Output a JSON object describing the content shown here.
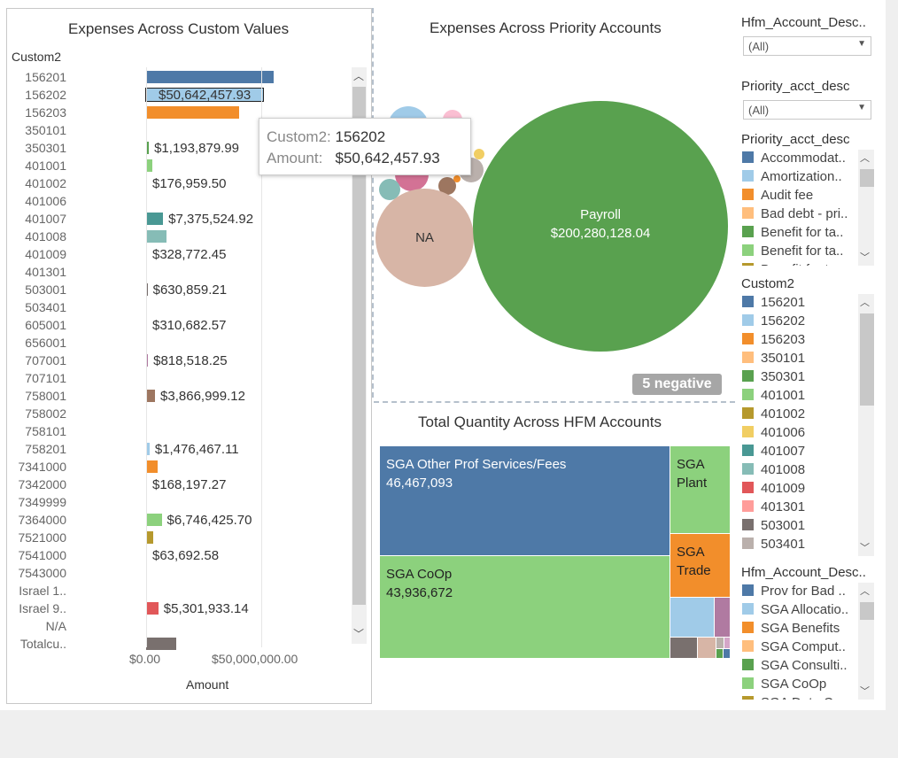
{
  "left_chart": {
    "title": "Expenses Across Custom Values",
    "dim_header": "Custom2",
    "x_axis_title": "Amount",
    "x_ticks": [
      "$0.00",
      "$50,000,000.00"
    ]
  },
  "tooltip": {
    "k1": "Custom2:",
    "v1": "156202",
    "k2": "Amount:",
    "v2": "$50,642,457.93"
  },
  "chart_data": [
    {
      "type": "bar",
      "title": "Expenses Across Custom Values",
      "xlabel": "Amount",
      "ylabel": "Custom2",
      "xlim": [
        0,
        95000000
      ],
      "rows": [
        {
          "cat": "156201",
          "value": 55500000,
          "label": "",
          "color": "#4e79a7"
        },
        {
          "cat": "156202",
          "value": 50642457.93,
          "label": "$50,642,457.93",
          "color": "#a0cbe8"
        },
        {
          "cat": "156203",
          "value": 40500000,
          "label": "",
          "color": "#f28e2b"
        },
        {
          "cat": "350101",
          "value": 150000,
          "label": "",
          "color": "#ffbe7d"
        },
        {
          "cat": "350301",
          "value": 1193879.99,
          "label": "$1,193,879.99",
          "color": "#59a14f"
        },
        {
          "cat": "401001",
          "value": 2600000,
          "label": "",
          "color": "#8cd17d"
        },
        {
          "cat": "401002",
          "value": 176959.5,
          "label": "$176,959.50",
          "color": "#b6992d"
        },
        {
          "cat": "401006",
          "value": 100000,
          "label": "",
          "color": "#f1ce63"
        },
        {
          "cat": "401007",
          "value": 7375524.92,
          "label": "$7,375,524.92",
          "color": "#499894"
        },
        {
          "cat": "401008",
          "value": 8800000,
          "label": "",
          "color": "#86bcb6"
        },
        {
          "cat": "401009",
          "value": 328772.45,
          "label": "$328,772.45",
          "color": "#e15759"
        },
        {
          "cat": "401301",
          "value": 300000,
          "label": "",
          "color": "#ff9d9a"
        },
        {
          "cat": "503001",
          "value": 630859.21,
          "label": "$630,859.21",
          "color": "#79706e"
        },
        {
          "cat": "503401",
          "value": 150000,
          "label": "",
          "color": "#bab0ac"
        },
        {
          "cat": "605001",
          "value": 310682.57,
          "label": "$310,682.57",
          "color": "#d37295"
        },
        {
          "cat": "656001",
          "value": 150000,
          "label": "",
          "color": "#fabfd2"
        },
        {
          "cat": "707001",
          "value": 818518.25,
          "label": "$818,518.25",
          "color": "#b07aa1"
        },
        {
          "cat": "707101",
          "value": 150000,
          "label": "",
          "color": "#d4a6c8"
        },
        {
          "cat": "758001",
          "value": 3866999.12,
          "label": "$3,866,999.12",
          "color": "#9d7660"
        },
        {
          "cat": "758002",
          "value": 150000,
          "label": "",
          "color": "#d7b5a6"
        },
        {
          "cat": "758101",
          "value": 400000,
          "label": "",
          "color": "#4e79a7"
        },
        {
          "cat": "758201",
          "value": 1476467.11,
          "label": "$1,476,467.11",
          "color": "#a0cbe8"
        },
        {
          "cat": "7341000",
          "value": 5000000,
          "label": "",
          "color": "#f28e2b"
        },
        {
          "cat": "7342000",
          "value": 168197.27,
          "label": "$168,197.27",
          "color": "#ffbe7d"
        },
        {
          "cat": "7349999",
          "value": 150000,
          "label": "",
          "color": "#59a14f"
        },
        {
          "cat": "7364000",
          "value": 6746425.7,
          "label": "$6,746,425.70",
          "color": "#8cd17d"
        },
        {
          "cat": "7521000",
          "value": 3200000,
          "label": "",
          "color": "#b6992d"
        },
        {
          "cat": "7541000",
          "value": 63692.58,
          "label": "$63,692.58",
          "color": "#f1ce63"
        },
        {
          "cat": "7543000",
          "value": 150000,
          "label": "",
          "color": "#499894"
        },
        {
          "cat": "Israel 1..",
          "value": 400000,
          "label": "",
          "color": "#86bcb6"
        },
        {
          "cat": "Israel 9..",
          "value": 5301933.14,
          "label": "$5,301,933.14",
          "color": "#e15759"
        },
        {
          "cat": "N/A",
          "value": 150000,
          "label": "",
          "color": "#ff9d9a"
        },
        {
          "cat": "Totalcu..",
          "value": 13000000,
          "label": "",
          "color": "#79706e"
        }
      ]
    },
    {
      "type": "bubble",
      "title": "Expenses Across Priority Accounts",
      "bubbles": [
        {
          "name": "Payroll",
          "label": "$200,280,128.04",
          "color": "#59a14f"
        },
        {
          "name": "NA",
          "label": "",
          "color": "#d7b5a6"
        }
      ],
      "badge": "5 negative"
    },
    {
      "type": "treemap",
      "title": "Total Quantity Across HFM Accounts",
      "items": [
        {
          "name": "SGA Other Prof Services/Fees",
          "value": 46467093,
          "color": "#4e79a7"
        },
        {
          "name": "SGA CoOp",
          "value": 43936672,
          "color": "#8cd17d"
        },
        {
          "name": "SGA Plant",
          "value": null,
          "color": "#8cd17d"
        },
        {
          "name": "SGA Trade",
          "value": null,
          "color": "#f28e2b"
        }
      ]
    }
  ],
  "filters": {
    "hfm_title": "Hfm_Account_Desc..",
    "hfm_value": "(All)",
    "prio_title": "Priority_acct_desc",
    "prio_value": "(All)"
  },
  "legend_priority": {
    "title": "Priority_acct_desc",
    "items": [
      {
        "label": "Accommodat..",
        "color": "#4e79a7"
      },
      {
        "label": "Amortization..",
        "color": "#a0cbe8"
      },
      {
        "label": "Audit fee",
        "color": "#f28e2b"
      },
      {
        "label": "Bad debt - pri..",
        "color": "#ffbe7d"
      },
      {
        "label": "Benefit for ta..",
        "color": "#59a14f"
      },
      {
        "label": "Benefit for ta..",
        "color": "#8cd17d"
      },
      {
        "label": "Benefit for t..",
        "color": "#b6992d"
      }
    ]
  },
  "legend_custom2": {
    "title": "Custom2",
    "items": [
      {
        "label": "156201",
        "color": "#4e79a7"
      },
      {
        "label": "156202",
        "color": "#a0cbe8"
      },
      {
        "label": "156203",
        "color": "#f28e2b"
      },
      {
        "label": "350101",
        "color": "#ffbe7d"
      },
      {
        "label": "350301",
        "color": "#59a14f"
      },
      {
        "label": "401001",
        "color": "#8cd17d"
      },
      {
        "label": "401002",
        "color": "#b6992d"
      },
      {
        "label": "401006",
        "color": "#f1ce63"
      },
      {
        "label": "401007",
        "color": "#499894"
      },
      {
        "label": "401008",
        "color": "#86bcb6"
      },
      {
        "label": "401009",
        "color": "#e15759"
      },
      {
        "label": "401301",
        "color": "#ff9d9a"
      },
      {
        "label": "503001",
        "color": "#79706e"
      },
      {
        "label": "503401",
        "color": "#bab0ac"
      }
    ]
  },
  "legend_hfm": {
    "title": "Hfm_Account_Desc..",
    "items": [
      {
        "label": "Prov for Bad ..",
        "color": "#4e79a7"
      },
      {
        "label": "SGA Allocatio..",
        "color": "#a0cbe8"
      },
      {
        "label": "SGA Benefits",
        "color": "#f28e2b"
      },
      {
        "label": "SGA Comput..",
        "color": "#ffbe7d"
      },
      {
        "label": "SGA Consulti..",
        "color": "#59a14f"
      },
      {
        "label": "SGA CoOp",
        "color": "#8cd17d"
      },
      {
        "label": "SGA Data C..",
        "color": "#b6992d"
      }
    ]
  }
}
